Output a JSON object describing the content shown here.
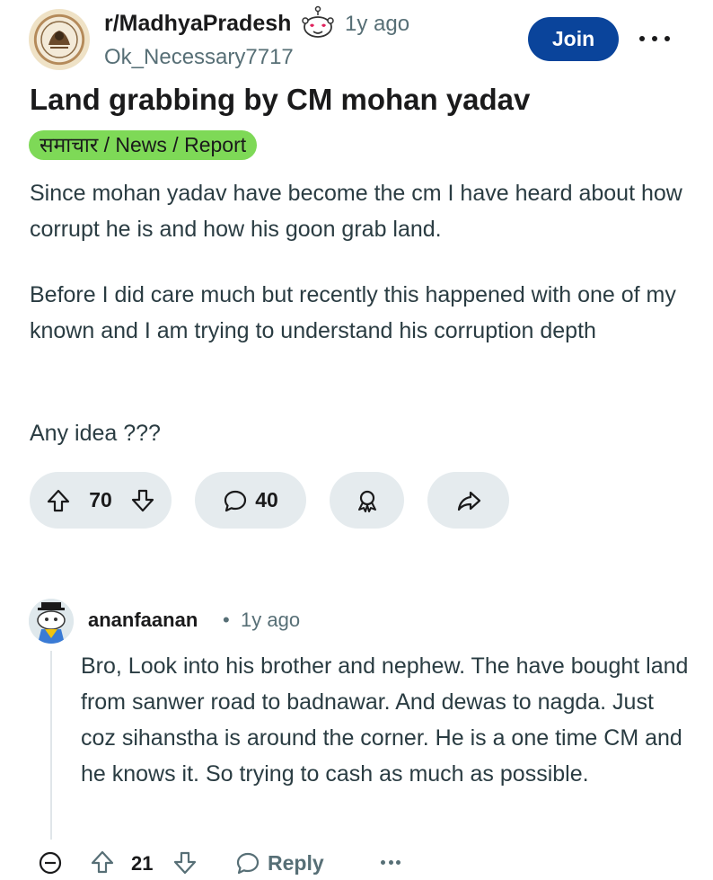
{
  "post": {
    "subreddit": "r/MadhyaPradesh",
    "time": "1y ago",
    "author": "Ok_Necessary7717",
    "join_label": "Join",
    "title": "Land grabbing by CM mohan yadav",
    "flair": "समाचार / News / Report",
    "flair_color": "#7ed957",
    "paragraphs": [
      "Since mohan yadav have become the cm I have heard about how corrupt he is and how his goon grab land.",
      "Before I did care much but recently this happened with one of my known and I am trying to understand his corruption depth",
      "Any idea ???"
    ],
    "votes": "70",
    "comments": "40",
    "join_color": "#0a449b"
  },
  "comment": {
    "author": "ananfaanan",
    "separator": "•",
    "time": "1y ago",
    "body": "Bro, Look into his brother and nephew. The have bought land from sanwer road to badnawar. And dewas to nagda. Just coz sihanstha is around the corner. He is a one time CM and he knows it. So trying to cash as much as possible.",
    "score": "21",
    "reply_label": "Reply"
  },
  "icons": {
    "subreddit_avatar": "emblem-icon",
    "snoo": "snoo-avatar-icon",
    "more": "more-horizontal-icon",
    "upvote": "upvote-arrow-icon",
    "downvote": "downvote-arrow-icon",
    "comment": "speech-bubble-icon",
    "award": "award-icon",
    "share": "share-arrow-icon",
    "collapse": "collapse-minus-icon",
    "reply": "reply-bubble-icon"
  }
}
